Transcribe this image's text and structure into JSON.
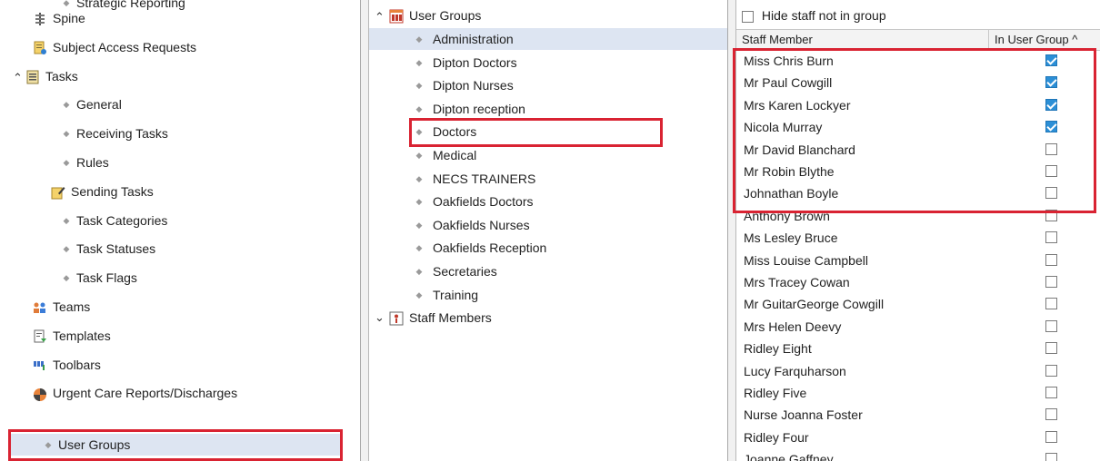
{
  "left_tree": [
    {
      "label": "Strategic Reporting",
      "icon": "bullet",
      "indent": 2
    },
    {
      "label": "Spine",
      "icon": "spine-icon",
      "indent": 1
    },
    {
      "label": "Subject Access Requests",
      "icon": "document-icon",
      "indent": 1
    },
    {
      "label": "Tasks",
      "icon": "tasks-icon",
      "indent": 0,
      "expanded": true
    },
    {
      "label": "General",
      "icon": "bullet",
      "indent": 2
    },
    {
      "label": "Receiving Tasks",
      "icon": "bullet",
      "indent": 2
    },
    {
      "label": "Rules",
      "icon": "bullet",
      "indent": 2
    },
    {
      "label": "Sending Tasks",
      "icon": "edit-icon",
      "indent": 2
    },
    {
      "label": "Task Categories",
      "icon": "bullet",
      "indent": 2
    },
    {
      "label": "Task Statuses",
      "icon": "bullet",
      "indent": 2
    },
    {
      "label": "Task Flags",
      "icon": "bullet",
      "indent": 2
    },
    {
      "label": "Teams",
      "icon": "teams-icon",
      "indent": 1
    },
    {
      "label": "Templates",
      "icon": "templates-icon",
      "indent": 1
    },
    {
      "label": "Toolbars",
      "icon": "toolbars-icon",
      "indent": 1
    },
    {
      "label": "Urgent Care Reports/Discharges",
      "icon": "urgent-care-icon",
      "indent": 1
    },
    {
      "label": "User Groups",
      "icon": "bullet",
      "indent": 1,
      "selected": true
    }
  ],
  "middle_tree": {
    "root_label": "User Groups",
    "groups": [
      {
        "label": "Administration",
        "selected": true
      },
      {
        "label": "Dipton Doctors"
      },
      {
        "label": "Dipton Nurses"
      },
      {
        "label": "Dipton reception"
      },
      {
        "label": "Doctors"
      },
      {
        "label": "Medical"
      },
      {
        "label": "NECS TRAINERS"
      },
      {
        "label": "Oakfields Doctors"
      },
      {
        "label": "Oakfields Nurses"
      },
      {
        "label": "Oakfields Reception"
      },
      {
        "label": "Secretaries"
      },
      {
        "label": "Training"
      }
    ],
    "staff_label": "Staff Members"
  },
  "staff_panel": {
    "hide_label": "Hide staff not in group",
    "col_staff": "Staff Member",
    "col_group": "In User Group ^",
    "rows": [
      {
        "name": "Miss Chris Burn",
        "in_group": true
      },
      {
        "name": "Mr Paul Cowgill",
        "in_group": true
      },
      {
        "name": "Mrs Karen Lockyer",
        "in_group": true
      },
      {
        "name": "Nicola Murray",
        "in_group": true
      },
      {
        "name": "Mr David Blanchard",
        "in_group": false
      },
      {
        "name": "Mr Robin Blythe",
        "in_group": false
      },
      {
        "name": "Johnathan Boyle",
        "in_group": false
      },
      {
        "name": "Anthony Brown",
        "in_group": false
      },
      {
        "name": "Ms Lesley Bruce",
        "in_group": false
      },
      {
        "name": "Miss Louise Campbell",
        "in_group": false
      },
      {
        "name": "Mrs Tracey Cowan",
        "in_group": false
      },
      {
        "name": "Mr GuitarGeorge Cowgill",
        "in_group": false
      },
      {
        "name": "Mrs Helen Deevy",
        "in_group": false
      },
      {
        "name": "Ridley Eight",
        "in_group": false
      },
      {
        "name": "Lucy Farquharson",
        "in_group": false
      },
      {
        "name": "Ridley Five",
        "in_group": false
      },
      {
        "name": "Nurse Joanna Foster",
        "in_group": false
      },
      {
        "name": "Ridley Four",
        "in_group": false
      },
      {
        "name": "Joanne Gaffney",
        "in_group": false
      }
    ]
  },
  "colors": {
    "highlight_box": "#d92332",
    "selection": "#dde5f2",
    "check": "#2c8fd6"
  }
}
